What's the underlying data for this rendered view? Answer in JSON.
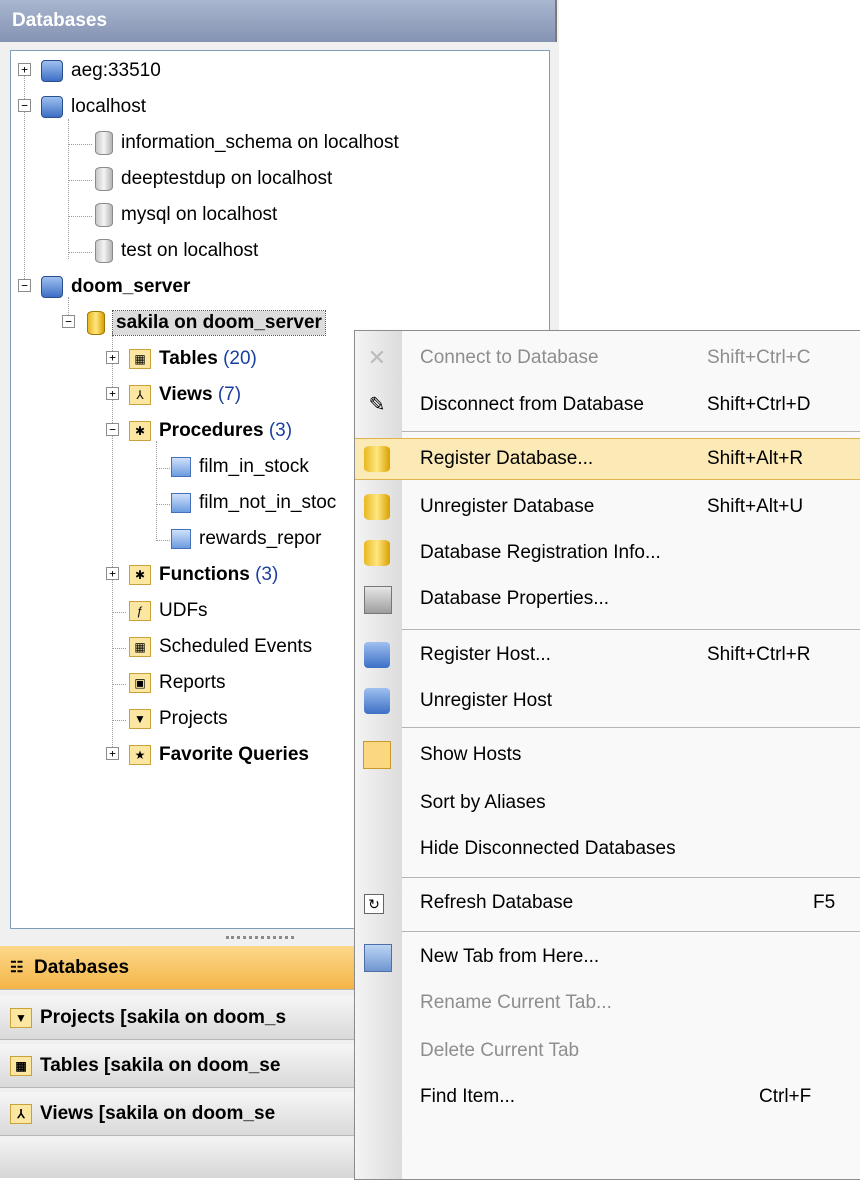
{
  "panel": {
    "title": "Databases"
  },
  "tree": {
    "nodes": [
      {
        "id": "aeg",
        "label": "aeg:33510"
      },
      {
        "id": "localhost",
        "label": "localhost"
      },
      {
        "id": "information_schema",
        "label": "information_schema on localhost"
      },
      {
        "id": "deeptestdup",
        "label": "deeptestdup on localhost"
      },
      {
        "id": "mysql",
        "label": "mysql on localhost"
      },
      {
        "id": "test",
        "label": "test on localhost"
      },
      {
        "id": "doom_server",
        "label": "doom_server"
      },
      {
        "id": "sakila",
        "label": "sakila on doom_server"
      },
      {
        "id": "tables",
        "label": "Tables",
        "count": "(20)"
      },
      {
        "id": "views",
        "label": "Views",
        "count": "(7)"
      },
      {
        "id": "procedures",
        "label": "Procedures",
        "count": "(3)"
      },
      {
        "id": "film_in_stock",
        "label": "film_in_stock"
      },
      {
        "id": "film_not_in_stock",
        "label": "film_not_in_stoc"
      },
      {
        "id": "rewards_report",
        "label": "rewards_repor"
      },
      {
        "id": "functions",
        "label": "Functions",
        "count": "(3)"
      },
      {
        "id": "udfs",
        "label": "UDFs"
      },
      {
        "id": "scheduled_events",
        "label": "Scheduled Events"
      },
      {
        "id": "reports",
        "label": "Reports"
      },
      {
        "id": "projects",
        "label": "Projects"
      },
      {
        "id": "favorite_queries",
        "label": "Favorite Queries"
      }
    ]
  },
  "nav": {
    "databases": "Databases",
    "projects": "Projects [sakila on doom_s",
    "tables": "Tables [sakila on doom_se",
    "views": "Views [sakila on doom_se",
    "more": "»"
  },
  "menu": {
    "items": [
      {
        "label": "Connect to Database",
        "shortcut": "Shift+Ctrl+C"
      },
      {
        "label": "Disconnect from Database",
        "shortcut": "Shift+Ctrl+D"
      },
      {
        "label": "Register Database...",
        "shortcut": "Shift+Alt+R"
      },
      {
        "label": "Unregister Database",
        "shortcut": "Shift+Alt+U"
      },
      {
        "label": "Database Registration Info...",
        "shortcut": ""
      },
      {
        "label": "Database Properties...",
        "shortcut": ""
      },
      {
        "label": "Register Host...",
        "shortcut": "Shift+Ctrl+R"
      },
      {
        "label": "Unregister Host",
        "shortcut": ""
      },
      {
        "label": "Show Hosts",
        "shortcut": ""
      },
      {
        "label": "Sort by Aliases",
        "shortcut": ""
      },
      {
        "label": "Hide Disconnected Databases",
        "shortcut": ""
      },
      {
        "label": "Refresh Database",
        "shortcut": "F5"
      },
      {
        "label": "New Tab from Here...",
        "shortcut": ""
      },
      {
        "label": "Rename Current Tab...",
        "shortcut": ""
      },
      {
        "label": "Delete Current Tab",
        "shortcut": ""
      },
      {
        "label": "Find Item...",
        "shortcut": "Ctrl+F"
      }
    ]
  }
}
